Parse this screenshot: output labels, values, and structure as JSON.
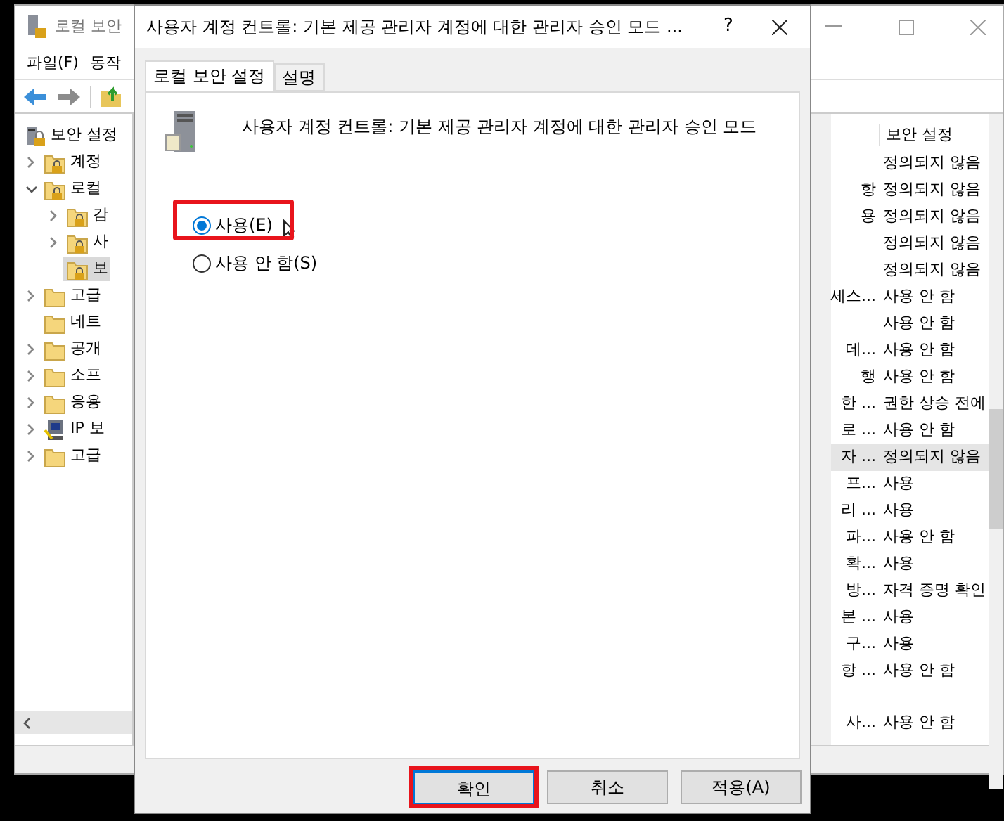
{
  "main_window": {
    "title": "로컬 보안",
    "menu": [
      "파일(F)",
      "동작"
    ],
    "tree": [
      {
        "label": "보안 설정",
        "kind": "policy",
        "selected": false,
        "children": [
          {
            "label": "계정",
            "kind": "locked",
            "expanded": false,
            "selected": false
          },
          {
            "label": "로컬",
            "kind": "locked",
            "expanded": true,
            "selected": false,
            "children": [
              {
                "label": "감",
                "kind": "locked",
                "expanded": false,
                "selected": false
              },
              {
                "label": "사",
                "kind": "locked",
                "expanded": false,
                "selected": false
              },
              {
                "label": "보",
                "kind": "locked",
                "selected": true
              }
            ]
          },
          {
            "label": "고급",
            "kind": "folder",
            "expanded": false,
            "selected": false
          },
          {
            "label": "네트",
            "kind": "folder",
            "selected": false
          },
          {
            "label": "공개",
            "kind": "folder",
            "expanded": false,
            "selected": false
          },
          {
            "label": "소프",
            "kind": "folder",
            "expanded": false,
            "selected": false
          },
          {
            "label": "응용",
            "kind": "folder",
            "expanded": false,
            "selected": false
          },
          {
            "label": "IP 보",
            "kind": "ip",
            "expanded": false,
            "selected": false
          },
          {
            "label": "고급",
            "kind": "folder",
            "expanded": false,
            "selected": false
          }
        ]
      }
    ],
    "list_header": "보안 설정",
    "rows": [
      {
        "setting": "정의되지 않음",
        "selected": false
      },
      {
        "column_1": "항",
        "setting": "정의되지 않음",
        "selected": false
      },
      {
        "column_1": "용",
        "setting": "정의되지 않음",
        "selected": false
      },
      {
        "setting": "정의되지 않음",
        "selected": false
      },
      {
        "setting": "정의되지 않음",
        "selected": false
      },
      {
        "column_1": "세스...",
        "setting": "사용 안 함",
        "selected": false
      },
      {
        "setting": "사용 안 함",
        "selected": false
      },
      {
        "column_1": "데...",
        "setting": "사용 안 함",
        "selected": false
      },
      {
        "column_1": "행",
        "setting": "사용 안 함",
        "selected": false
      },
      {
        "column_1": "한 ...",
        "setting": "권한 상승 전에",
        "selected": false
      },
      {
        "column_1": "로 ...",
        "setting": "사용 안 함",
        "selected": false
      },
      {
        "column_1": "자 ...",
        "setting": "정의되지 않음",
        "selected": true
      },
      {
        "column_1": "프...",
        "setting": "사용",
        "selected": false
      },
      {
        "column_1": "리 ...",
        "setting": "사용",
        "selected": false
      },
      {
        "column_1": "파...",
        "setting": "사용 안 함",
        "selected": false
      },
      {
        "column_1": "확...",
        "setting": "사용",
        "selected": false
      },
      {
        "column_1": "방...",
        "setting": "자격 증명 확인",
        "selected": false
      },
      {
        "column_1": "본 ...",
        "setting": "사용",
        "selected": false
      },
      {
        "column_1": "구...",
        "setting": "사용",
        "selected": false
      },
      {
        "column_1": "항 ...",
        "setting": "사용 안 함",
        "selected": false
      },
      {
        "column_1": "사...",
        "setting": "사용 안 함",
        "selected": false,
        "gap_before": true
      }
    ]
  },
  "dialog": {
    "title": "사용자 계정 컨트롤: 기본 제공 관리자 계정에 대한 관리자 승인 모드 ...",
    "help": "?",
    "tabs": [
      {
        "label": "로컬 보안 설정",
        "selected": true
      },
      {
        "label": "설명",
        "selected": false
      }
    ],
    "policy_name": "사용자 계정 컨트롤: 기본 제공 관리자 계정에 대한 관리자 승인 모드",
    "options": [
      {
        "label": "사용(E)",
        "selected": true,
        "highlighted": true
      },
      {
        "label": "사용 안 함(S)",
        "selected": false,
        "highlighted": false
      }
    ],
    "buttons": [
      {
        "label": "확인",
        "default": true,
        "highlighted": true
      },
      {
        "label": "취소",
        "default": false,
        "highlighted": false
      },
      {
        "label": "적용(A)",
        "default": false,
        "highlighted": false
      }
    ]
  }
}
